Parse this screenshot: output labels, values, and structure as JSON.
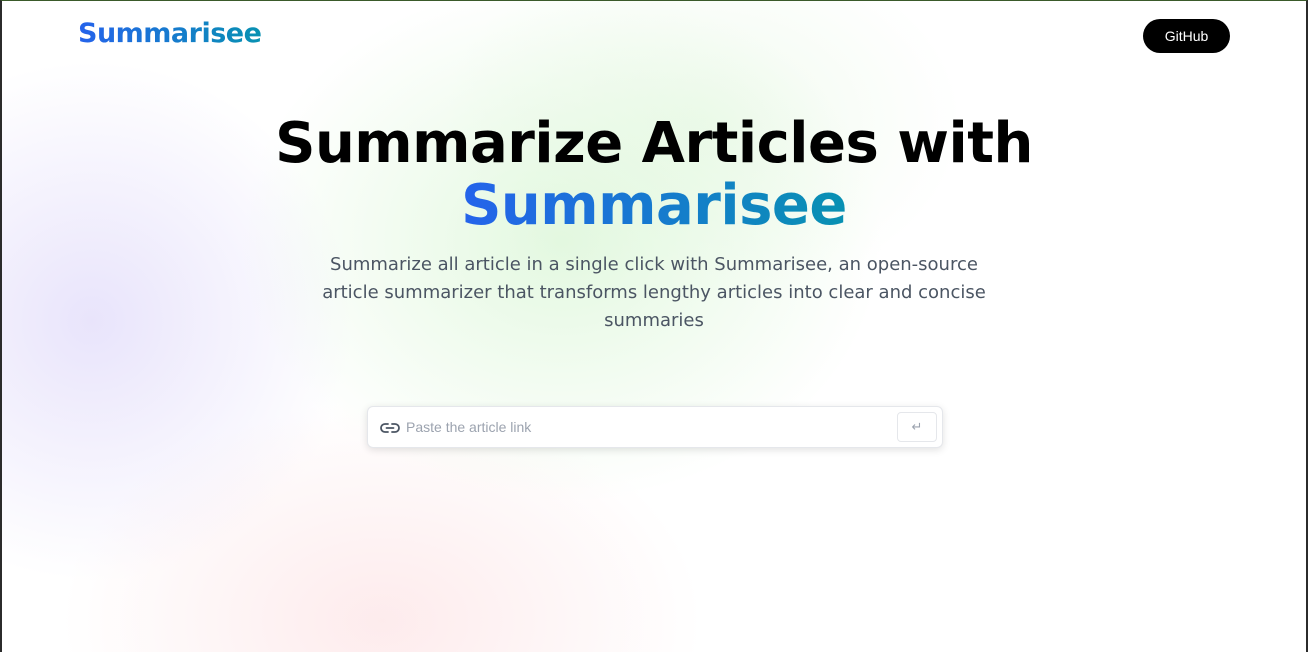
{
  "header": {
    "logo_text": "Summarisee",
    "github_label": "GitHub"
  },
  "hero": {
    "title_line1": "Summarize Articles with",
    "title_line2": "Summarisee",
    "description": "Summarize all article in a single click with Summarisee, an open-source article summarizer that transforms lengthy articles into clear and concise summaries"
  },
  "search": {
    "placeholder": "Paste the article link",
    "value": "",
    "submit_symbol": "↵",
    "icon": "link-icon"
  },
  "colors": {
    "brand_gradient_start": "#2563eb",
    "brand_gradient_end": "#0891b2",
    "button_bg": "#000000"
  }
}
